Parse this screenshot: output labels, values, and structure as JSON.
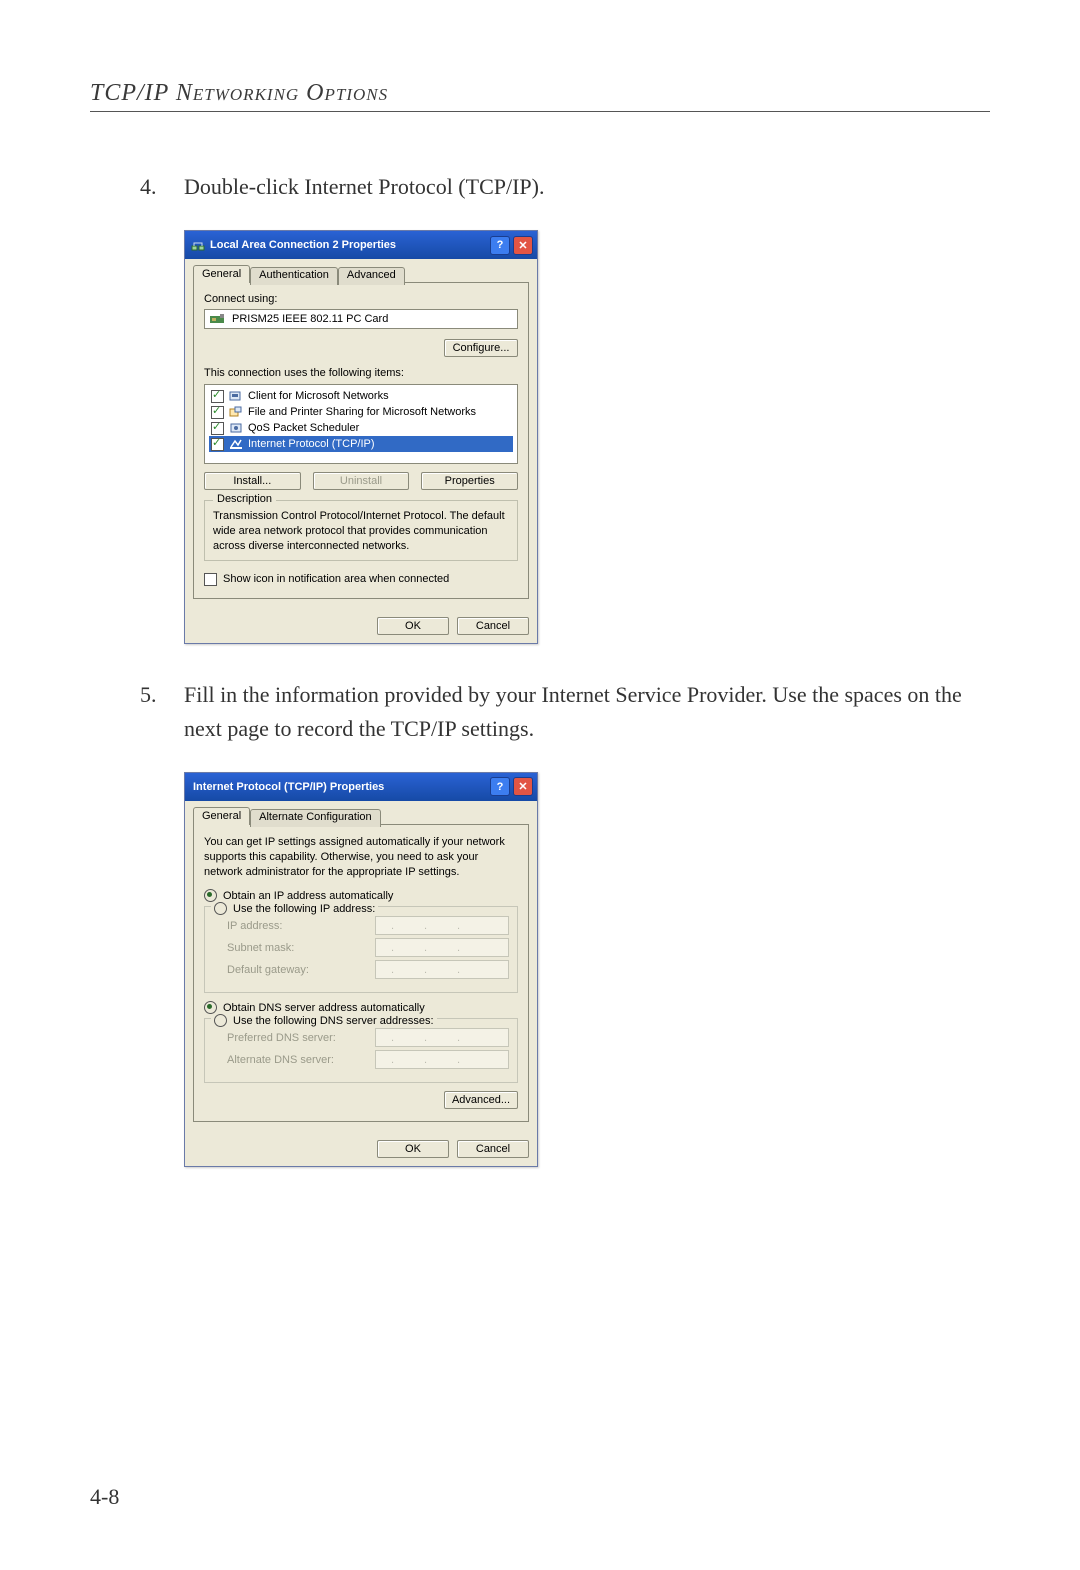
{
  "header": "TCP/IP Networking Options",
  "page_number": "4-8",
  "steps": {
    "4": {
      "num": "4.",
      "text": "Double-click Internet Protocol (TCP/IP)."
    },
    "5": {
      "num": "5.",
      "text": "Fill in the information provided by your Internet Service Provider. Use the spaces on the next page to record the TCP/IP settings."
    }
  },
  "dlg1": {
    "title": "Local Area Connection 2 Properties",
    "help_glyph": "?",
    "close_glyph": "✕",
    "tabs": {
      "general": "General",
      "auth": "Authentication",
      "adv": "Advanced"
    },
    "connect_using_label": "Connect using:",
    "adapter": "PRISM25 IEEE 802.11 PC Card",
    "configure_btn": "Configure...",
    "uses_label": "This connection uses the following items:",
    "items": [
      {
        "label": "Client for Microsoft Networks"
      },
      {
        "label": "File and Printer Sharing for Microsoft Networks"
      },
      {
        "label": "QoS Packet Scheduler"
      },
      {
        "label": "Internet Protocol (TCP/IP)"
      }
    ],
    "install_btn": "Install...",
    "uninstall_btn": "Uninstall",
    "properties_btn": "Properties",
    "desc_title": "Description",
    "desc_text": "Transmission Control Protocol/Internet Protocol. The default wide area network protocol that provides communication across diverse interconnected networks.",
    "show_icon_label": "Show icon in notification area when connected",
    "ok_btn": "OK",
    "cancel_btn": "Cancel"
  },
  "dlg2": {
    "title": "Internet Protocol (TCP/IP) Properties",
    "help_glyph": "?",
    "close_glyph": "✕",
    "tabs": {
      "general": "General",
      "alt": "Alternate Configuration"
    },
    "info": "You can get IP settings assigned automatically if your network supports this capability. Otherwise, you need to ask your network administrator for the appropriate IP settings.",
    "r_ip_auto": "Obtain an IP address automatically",
    "r_ip_manual": "Use the following IP address:",
    "ip_label": "IP address:",
    "subnet_label": "Subnet mask:",
    "gateway_label": "Default gateway:",
    "r_dns_auto": "Obtain DNS server address automatically",
    "r_dns_manual": "Use the following DNS server addresses:",
    "pref_dns_label": "Preferred DNS server:",
    "alt_dns_label": "Alternate DNS server:",
    "advanced_btn": "Advanced...",
    "ok_btn": "OK",
    "cancel_btn": "Cancel"
  }
}
